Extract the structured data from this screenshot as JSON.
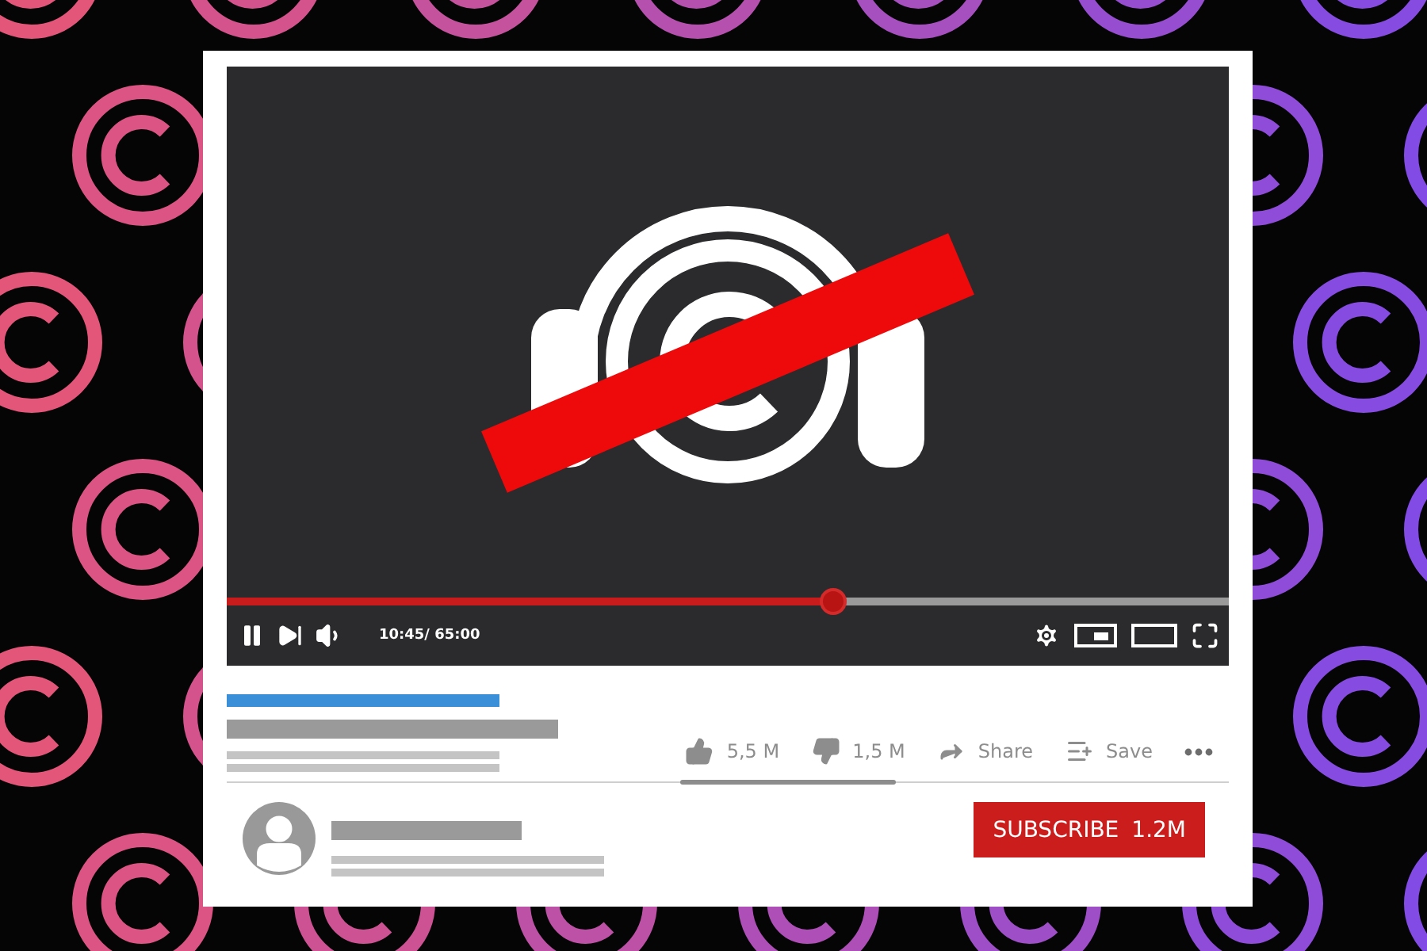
{
  "player": {
    "playing": true,
    "progress": {
      "level": 0.605
    },
    "time": "10:45/ 65:00"
  },
  "actions": [
    {
      "kind": "like",
      "label": "5,5 M"
    },
    {
      "kind": "dislike",
      "label": "1,5 M"
    },
    {
      "kind": "share",
      "label": "Share"
    },
    {
      "kind": "save",
      "label": "Save"
    },
    {
      "kind": "more"
    }
  ],
  "subscribe": {
    "label": "SUBSCRIBE",
    "count": "1.2M"
  }
}
